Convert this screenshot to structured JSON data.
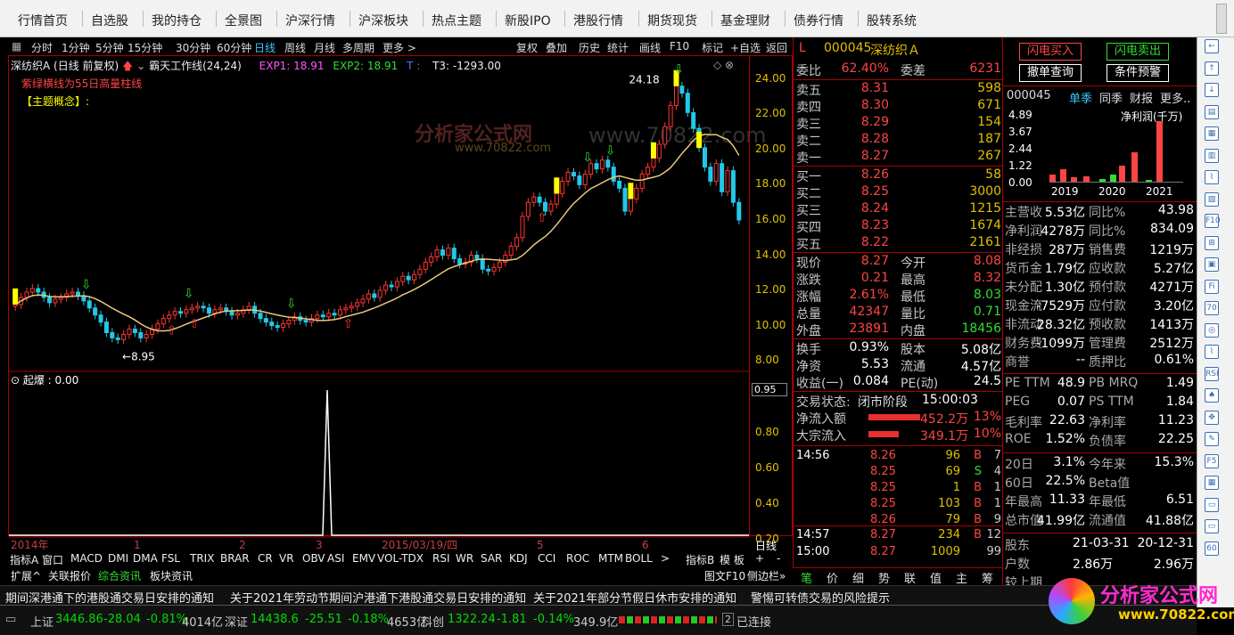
{
  "topnav": [
    "行情首页",
    "自选股",
    "我的持仓",
    "全景图",
    "沪深行情",
    "沪深板块",
    "热点主题",
    "新股IPO",
    "港股行情",
    "期货现货",
    "基金理财",
    "债券行情",
    "股转系统"
  ],
  "period": {
    "items": [
      "分时",
      "1分钟",
      "5分钟",
      "15分钟",
      "30分钟",
      "60分钟",
      "日线",
      "周线",
      "月线",
      "多周期",
      "更多 >"
    ],
    "active": "日线",
    "tools": [
      "复权",
      "叠加",
      "历史",
      "统计",
      "画线",
      "F10",
      "标记",
      "+自选",
      "返回"
    ]
  },
  "chart": {
    "title": "深纺织A (日线 前复权)",
    "indicator": "霸天工作线(24,24)",
    "exp1": "EXP1: 18.91",
    "exp2": "EXP2: 18.91",
    "t": "T :",
    "t3": "T3: -1293.00",
    "note": "紫绿横线为55日高量柱线",
    "concept": "【主题概念】:",
    "high_label": "24.18",
    "low_label": "8.95",
    "yticks": [
      "24.00",
      "22.00",
      "20.00",
      "18.00",
      "16.00",
      "14.00",
      "12.00",
      "10.00",
      "8.00"
    ],
    "xticks": [
      "2014年",
      "1",
      "2",
      "3",
      "2015/03/19/四",
      "5",
      "6"
    ],
    "period_label": "日线",
    "watermark1": "分析家公式网",
    "watermark2": "www.70822.com",
    "watermark3": "www.70822.com"
  },
  "sub": {
    "label": "起爆 : 0.00",
    "value": "0.95",
    "yticks": [
      "0.80",
      "0.60",
      "0.40",
      "0.20"
    ]
  },
  "indbar": [
    "指标A",
    "窗口",
    "MACD",
    "DMI",
    "DMA",
    "FSL",
    "TRIX",
    "BRAR",
    "CR",
    "VR",
    "OBV",
    "ASI",
    "EMV",
    "VOL-TDX",
    "RSI",
    "WR",
    "SAR",
    "KDJ",
    "CCI",
    "ROC",
    "MTM",
    "BOLL",
    ">",
    "指标B",
    "模 板",
    "+",
    "-"
  ],
  "tabbar": [
    "扩展^",
    "关联报价",
    "综合资讯",
    "板块资讯"
  ],
  "tabbar_right": [
    "图文F10",
    "侧边栏»"
  ],
  "quote": {
    "flag": "L",
    "code": "000045",
    "name": "深纺织Ａ",
    "weibi_l": "委比",
    "weibi": "62.40%",
    "weicha_l": "委差",
    "weicha": "6231",
    "sell": [
      [
        "卖五",
        "8.31",
        "598"
      ],
      [
        "卖四",
        "8.30",
        "671"
      ],
      [
        "卖三",
        "8.29",
        "154"
      ],
      [
        "卖二",
        "8.28",
        "187"
      ],
      [
        "卖一",
        "8.27",
        "267"
      ]
    ],
    "buy": [
      [
        "买一",
        "8.26",
        "58"
      ],
      [
        "买二",
        "8.25",
        "3000"
      ],
      [
        "买三",
        "8.24",
        "1215"
      ],
      [
        "买四",
        "8.23",
        "1674"
      ],
      [
        "买五",
        "8.22",
        "2161"
      ]
    ],
    "stats": [
      [
        "现价",
        "8.27",
        "今开",
        "8.08"
      ],
      [
        "涨跌",
        "0.21",
        "最高",
        "8.32"
      ],
      [
        "涨幅",
        "2.61%",
        "最低",
        "8.03"
      ],
      [
        "总量",
        "42347",
        "量比",
        "0.71"
      ],
      [
        "外盘",
        "23891",
        "内盘",
        "18456"
      ]
    ],
    "stats2": [
      [
        "换手",
        "0.93%",
        "股本",
        "5.08亿"
      ],
      [
        "净资",
        "5.53",
        "流通",
        "4.57亿"
      ],
      [
        "收益(一)",
        "0.084",
        "PE(动)",
        "24.5"
      ]
    ],
    "trade_status_l": "交易状态:",
    "trade_status": "闭市阶段",
    "trade_time": "15:00:03",
    "flow": [
      [
        "净流入额",
        "452.2万",
        "13%"
      ],
      [
        "大宗流入",
        "349.1万",
        "10%"
      ]
    ],
    "ticks": [
      [
        "14:56",
        "8.26",
        "96",
        "B",
        "7"
      ],
      [
        "",
        "8.25",
        "69",
        "S",
        "4"
      ],
      [
        "",
        "8.25",
        "1",
        "B",
        "1"
      ],
      [
        "",
        "8.25",
        "103",
        "B",
        "1"
      ],
      [
        "",
        "8.26",
        "79",
        "B",
        "9"
      ],
      [
        "14:57",
        "8.27",
        "234",
        "B",
        "12"
      ],
      [
        "15:00",
        "8.27",
        "1009",
        "",
        "99"
      ]
    ],
    "bottom_tabs": [
      "笔",
      "价",
      "细",
      "势",
      "联",
      "值",
      "主",
      "筹"
    ]
  },
  "fin": {
    "btn_buy": "闪电买入",
    "btn_sell": "闪电卖出",
    "btn_cancel": "撤单查询",
    "btn_alert": "条件预警",
    "code": "000045",
    "tabs": [
      "单季",
      "同季",
      "财报",
      "更多.."
    ],
    "chart_title": "净利润(千万)",
    "chart_y": [
      "4.89",
      "3.67",
      "2.44",
      "1.22",
      "0.00"
    ],
    "chart_x": [
      "2019",
      "2020",
      "2021"
    ],
    "rows": [
      [
        "主营收",
        "5.53亿",
        "同比%",
        "43.98"
      ],
      [
        "净利润",
        "4278万",
        "同比%",
        "834.09"
      ],
      [
        "非经损",
        "287万",
        "销售费",
        "1219万"
      ],
      [
        "货币金",
        "1.79亿",
        "应收款",
        "5.27亿"
      ],
      [
        "未分配",
        "1.30亿",
        "预付款",
        "4271万"
      ],
      [
        "现金流",
        "-7529万",
        "应付款",
        "3.20亿"
      ],
      [
        "非流动",
        "28.32亿",
        "预收款",
        "1413万"
      ],
      [
        "财务费",
        "-1099万",
        "管理费",
        "2512万"
      ],
      [
        "商誉",
        "--",
        "质押比",
        "0.61%"
      ]
    ],
    "rows2": [
      [
        "PE TTM",
        "48.9",
        "PB MRQ",
        "1.49"
      ],
      [
        "PEG",
        "0.07",
        "PS TTM",
        "1.84"
      ],
      [
        "毛利率",
        "22.63",
        "净利率",
        "11.23"
      ],
      [
        "ROE",
        "1.52%",
        "负债率",
        "22.25"
      ]
    ],
    "rows3": [
      [
        "20日",
        "3.1%",
        "今年来",
        "15.3%"
      ],
      [
        "60日",
        "22.5%",
        "Beta值",
        ""
      ],
      [
        "年最高",
        "11.33",
        "年最低",
        "6.51"
      ],
      [
        "总市值",
        "41.99亿",
        "流通值",
        "41.88亿"
      ]
    ],
    "rows4": [
      [
        "股东",
        "21-03-31",
        "20-12-31"
      ],
      [
        "户数",
        "2.86万",
        "2.96万"
      ],
      [
        "较上期",
        "",
        ""
      ]
    ]
  },
  "news": [
    "期间深港通下的港股通交易日安排的通知",
    "关于2021年劳动节期间沪港通下港股通交易日安排的通知",
    "关于2021年部分节假日休市安排的通知",
    "警惕可转债交易的风险提示"
  ],
  "status": {
    "sh_l": "上证",
    "sh": "3446.86",
    "sh_c": "-28.04",
    "sh_p": "-0.81%",
    "sh_a": "4014亿",
    "sz_l": "深证",
    "sz": "14438.6",
    "sz_c": "-25.51",
    "sz_p": "-0.18%",
    "sz_a": "4653亿",
    "kc_l": "科创",
    "kc": "1322.24",
    "kc_c": "-1.81",
    "kc_p": "-0.14%",
    "kc_a": "349.9亿",
    "conn": "已连接",
    "conn_n": "2"
  },
  "logo": {
    "text": "分析家公式网",
    "url": "www.70822.com"
  },
  "chart_data": {
    "type": "candlestick",
    "title": "深纺织A (日线 前复权)",
    "ylim": [
      7.5,
      24.8
    ],
    "close": [
      11.2,
      11.6,
      11.9,
      12.1,
      11.9,
      11.6,
      11.3,
      11.5,
      11.6,
      11.8,
      11.9,
      11.7,
      11.4,
      11.0,
      10.6,
      10.2,
      9.6,
      9.3,
      9.2,
      9.5,
      9.8,
      9.6,
      9.3,
      9.5,
      9.8,
      10.1,
      10.4,
      10.6,
      10.8,
      10.7,
      10.9,
      11.0,
      11.1,
      11.0,
      10.7,
      10.9,
      11.0,
      10.8,
      10.6,
      10.7,
      10.9,
      11.1,
      10.7,
      10.4,
      10.2,
      10.0,
      9.9,
      10.1,
      10.3,
      10.5,
      10.3,
      10.2,
      10.4,
      10.6,
      10.5,
      10.7,
      10.6,
      10.9,
      11.0,
      11.1,
      11.3,
      11.5,
      11.8,
      11.6,
      12.0,
      12.3,
      12.2,
      12.5,
      12.8,
      12.6,
      12.9,
      13.2,
      13.6,
      13.9,
      14.3,
      14.0,
      14.4,
      13.8,
      13.5,
      13.6,
      14.0,
      13.8,
      13.2,
      13.1,
      13.3,
      13.6,
      14.0,
      14.5,
      15.0,
      16.2,
      17.0,
      17.3,
      17.0,
      16.5,
      16.9,
      17.5,
      18.2,
      18.7,
      18.5,
      18.0,
      18.6,
      19.2,
      18.9,
      19.4,
      19.0,
      18.2,
      17.8,
      16.5,
      17.2,
      17.8,
      18.6,
      19.0,
      19.5,
      20.3,
      21.3,
      22.5,
      23.6,
      23.2,
      22.1,
      21.2,
      20.1,
      19.0,
      18.2,
      19.2,
      17.6,
      18.8,
      17.0,
      16.0
    ]
  },
  "fin_chart_data": {
    "type": "bar",
    "title": "净利润(千万)",
    "categories": [
      "2019",
      "2020",
      "2021"
    ],
    "ylim": [
      0,
      4.89
    ],
    "values": [
      0.5,
      0.9,
      0.3,
      0.4,
      0.2,
      0.5,
      1.1,
      2.1,
      0.1,
      4.28
    ]
  }
}
